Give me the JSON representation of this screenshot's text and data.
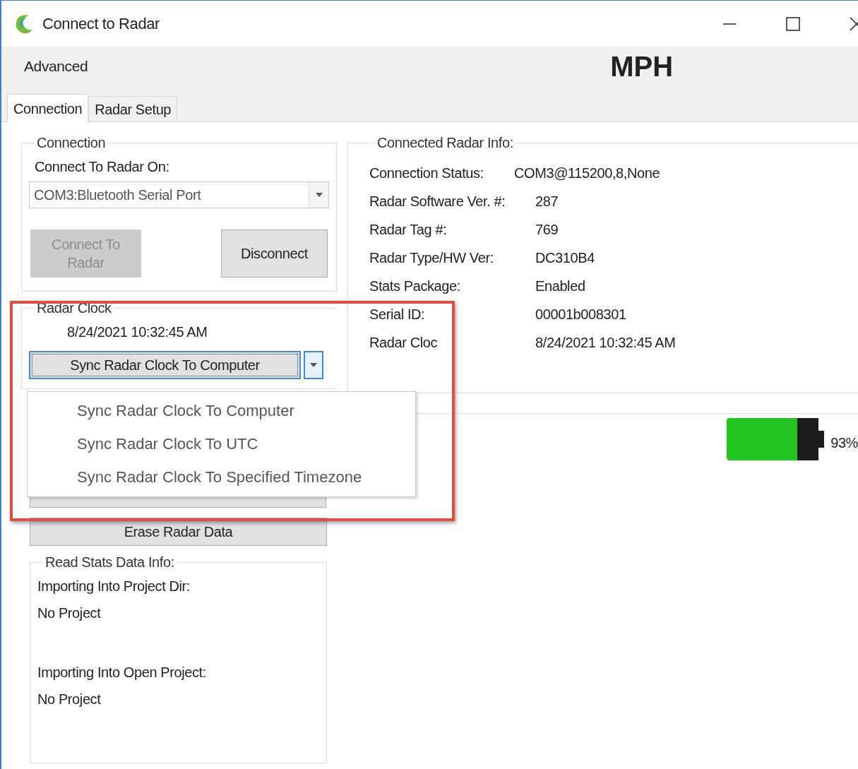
{
  "window": {
    "title": "Connect to Radar"
  },
  "menu": [
    "Advanced"
  ],
  "unit_label": "MPH",
  "tabs": [
    {
      "label": "Connection",
      "selected": true
    },
    {
      "label": "Radar Setup",
      "selected": false
    }
  ],
  "connection": {
    "title": "Connection",
    "port_label": "Connect To Radar On:",
    "port_value": "COM3:Bluetooth Serial Port",
    "buttons": [
      {
        "label": "Connect To Radar",
        "disabled": true
      },
      {
        "label": "Disconnect",
        "disabled": false
      }
    ]
  },
  "radar_clock": {
    "title": "Radar Clock",
    "time": "8/24/2021 10:32:45 AM",
    "sync_button": "Sync Radar Clock To Computer",
    "menu_items": [
      "Sync Radar Clock To Computer",
      "Sync Radar Clock To UTC",
      "Sync Radar Clock To Specified Timezone"
    ]
  },
  "erase_button": "Erase Radar Data",
  "read_stats": {
    "title": "Read Stats Data Info:",
    "lines": [
      "Importing Into Project Dir:",
      "No Project",
      "Importing Into Open Project:",
      "No Project"
    ]
  },
  "radar_info": {
    "title": "Connected Radar Info:",
    "rows": [
      {
        "label": "Connection Status:",
        "value": "COM3@115200,8,None"
      },
      {
        "label": "Radar Software Ver. #:",
        "value": "287"
      },
      {
        "label": "Radar Tag #:",
        "value": "769"
      },
      {
        "label": "Radar Type/HW Ver:",
        "value": "DC310B4"
      },
      {
        "label": "Stats Package:",
        "value": "Enabled"
      },
      {
        "label": "Serial ID:",
        "value": "00001b008301"
      },
      {
        "label": "Radar Cloc",
        "value": "8/24/2021 10:32:45 AM"
      }
    ]
  },
  "battery": {
    "reading": "93%"
  }
}
